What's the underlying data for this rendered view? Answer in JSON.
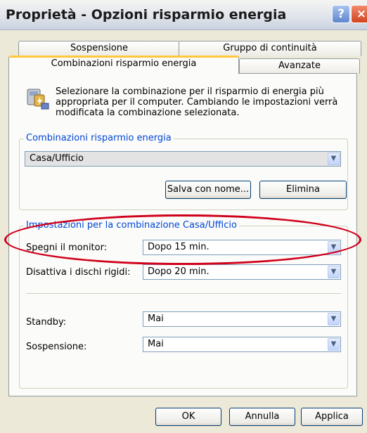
{
  "window": {
    "title": "Proprietà - Opzioni risparmio energia",
    "help_glyph": "?",
    "close_glyph": "×"
  },
  "tabs": [
    {
      "label": "Sospensione"
    },
    {
      "label": "Gruppo di continuità"
    },
    {
      "label": "Combinazioni risparmio energia",
      "active": true
    },
    {
      "label": "Avanzate"
    }
  ],
  "intro": {
    "icon": "power-options-icon",
    "text": "Selezionare la combinazione per il risparmio di energia più appropriata per il computer. Cambiando le impostazioni verrà modificata la combinazione selezionata."
  },
  "scheme_group": {
    "legend": "Combinazioni risparmio energia",
    "selected": "Casa/Ufficio",
    "save_as_label": "Salva con nome...",
    "delete_label": "Elimina"
  },
  "settings_group": {
    "legend": "Impostazioni per la combinazione Casa/Ufficio",
    "monitor_label": "Spegni il monitor:",
    "monitor_value": "Dopo 15 min.",
    "disks_label": "Disattiva i dischi rigidi:",
    "disks_value": "Dopo 20 min.",
    "standby_label": "Standby:",
    "standby_value": "Mai",
    "hibernate_label": "Sospensione:",
    "hibernate_value": "Mai"
  },
  "footer": {
    "ok_label": "OK",
    "cancel_label": "Annulla",
    "apply_label": "Applica"
  },
  "colors": {
    "highlight": "#d0001b",
    "legend": "#0046d5"
  }
}
